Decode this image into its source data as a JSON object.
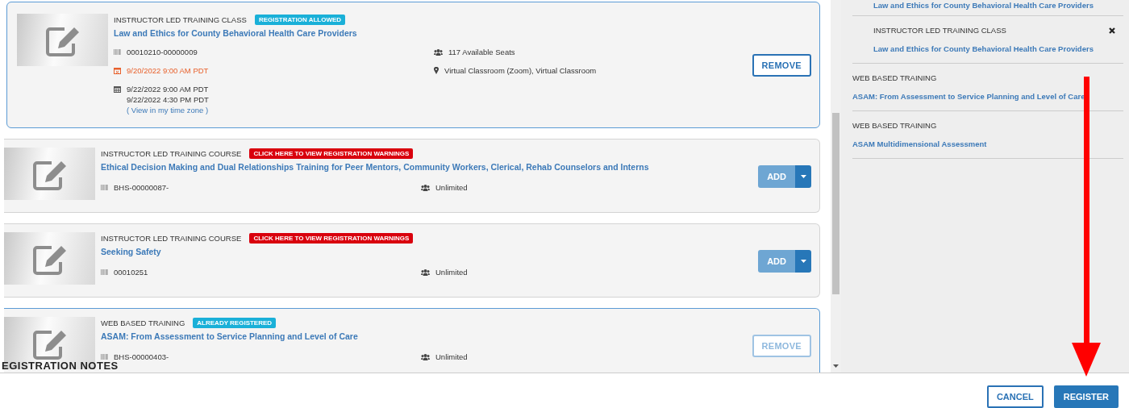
{
  "courses": [
    {
      "type": "INSTRUCTOR LED TRAINING CLASS",
      "badge": {
        "text": "REGISTRATION ALLOWED",
        "kind": "info"
      },
      "title": "Law and Ethics for County Behavioral Health Care Providers",
      "selected": true,
      "code": "00010210-00000009",
      "deadline": "9/20/2022 9:00 AM PDT",
      "session": [
        "9/22/2022 9:00 AM PDT",
        "9/22/2022 4:30 PM PDT"
      ],
      "timezone_link": "( View in my time zone )",
      "seats": "117 Available Seats",
      "location": "Virtual Classroom (Zoom), Virtual Classroom",
      "action": {
        "kind": "remove",
        "label": "REMOVE",
        "disabled": false
      }
    },
    {
      "type": "INSTRUCTOR LED TRAINING COURSE",
      "badge": {
        "text": "CLICK HERE TO VIEW REGISTRATION WARNINGS",
        "kind": "warning"
      },
      "title": "Ethical Decision Making and Dual Relationships Training for Peer Mentors, Community Workers, Clerical, Rehab Counselors and Interns",
      "selected": false,
      "code": "BHS-00000087-",
      "seats": "Unlimited",
      "action": {
        "kind": "add",
        "label": "ADD",
        "disabled": false
      }
    },
    {
      "type": "INSTRUCTOR LED TRAINING COURSE",
      "badge": {
        "text": "CLICK HERE TO VIEW REGISTRATION WARNINGS",
        "kind": "warning"
      },
      "title": "Seeking Safety",
      "selected": false,
      "code": "00010251",
      "seats": "Unlimited",
      "action": {
        "kind": "add",
        "label": "ADD",
        "disabled": false
      }
    },
    {
      "type": "WEB BASED TRAINING",
      "badge": {
        "text": "ALREADY REGISTERED",
        "kind": "info"
      },
      "title": "ASAM: From Assessment to Service Planning and Level of Care",
      "selected": true,
      "code": "BHS-00000403-",
      "seats": "Unlimited",
      "action": {
        "kind": "remove",
        "label": "REMOVE",
        "disabled": true
      }
    }
  ],
  "notes_heading": "EGISTRATION NOTES",
  "cart": [
    {
      "title": "Law and Ethics for County Behavioral Health Care Providers",
      "nested": true,
      "first": true
    },
    {
      "type": "INSTRUCTOR LED TRAINING CLASS",
      "title": "Law and Ethics for County Behavioral Health Care Providers",
      "nested": true,
      "removable": true
    },
    {
      "type": "WEB BASED TRAINING",
      "title": "ASAM: From Assessment to Service Planning and Level of Care",
      "nested": false,
      "removable": false
    },
    {
      "type": "WEB BASED TRAINING",
      "title": "ASAM Multidimensional Assessment",
      "nested": false,
      "removable": false
    }
  ],
  "buttons": [
    {
      "label": "CANCEL",
      "kind": "secondary"
    },
    {
      "label": "REGISTER",
      "kind": "primary"
    }
  ]
}
